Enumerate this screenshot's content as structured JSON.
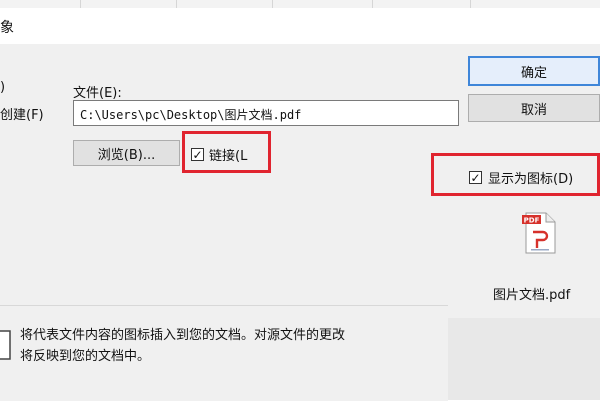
{
  "dialog": {
    "title_fragment": "象",
    "left_label_1": ")",
    "left_label_2": "创建(F)"
  },
  "file_field": {
    "label": "文件(E):",
    "value": "C:\\Users\\pc\\Desktop\\图片文档.pdf"
  },
  "buttons": {
    "ok": "确定",
    "cancel": "取消",
    "browse": "浏览(B)..."
  },
  "link_checkbox": {
    "label": "链接(L",
    "checked": true
  },
  "display_icon_checkbox": {
    "label": "显示为图标(D)",
    "checked": true
  },
  "preview": {
    "icon": "pdf-file-icon",
    "filename": "图片文档.pdf"
  },
  "result": {
    "line1": "将代表文件内容的图标插入到您的文档。对源文件的更改",
    "line2": "将反映到您的文档中。"
  },
  "colors": {
    "highlight_red": "#e0242f",
    "default_button_border": "#3f86d9",
    "pdf_red": "#d6312b"
  }
}
